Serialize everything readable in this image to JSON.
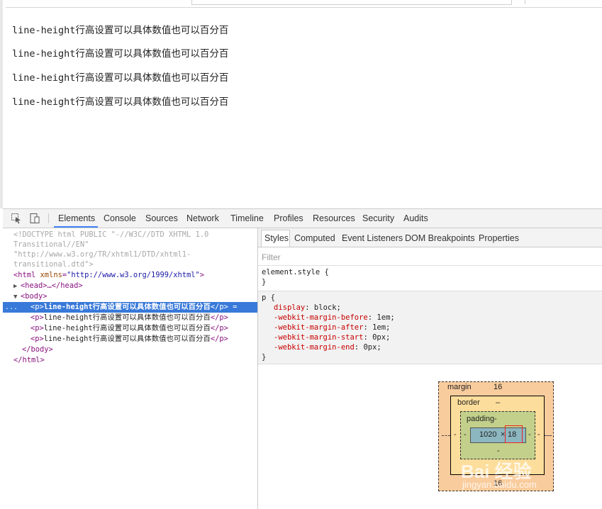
{
  "page": {
    "paragraphs": [
      "line-height行高设置可以具体数值也可以百分百",
      "line-height行高设置可以具体数值也可以百分百",
      "line-height行高设置可以具体数值也可以百分百",
      "line-height行高设置可以具体数值也可以百分百"
    ]
  },
  "devtools": {
    "tabs": [
      "Elements",
      "Console",
      "Sources",
      "Network",
      "Timeline",
      "Profiles",
      "Resources",
      "Security",
      "Audits"
    ],
    "active_tab": "Elements",
    "icons": {
      "inspect": "cursor-arrow-icon",
      "device": "mobile-device-icon"
    },
    "dom": {
      "doctype_1": "<!DOCTYPE html PUBLIC \"-//W3C//DTD XHTML 1.0",
      "doctype_2": "Transitional//EN\"",
      "doctype_3": "\"http://www.w3.org/TR/xhtml1/DTD/xhtml1-",
      "doctype_4": "transitional.dtd\">",
      "html_open": "<html",
      "html_attr": "xmlns",
      "html_val": "\"http://www.w3.org/1999/xhtml\"",
      "html_close": ">",
      "head": "<head>…</head>",
      "body_open": "<body>",
      "p_open": "<p>",
      "p_text": "line-height行高设置可以具体数值也可以百分百",
      "p_close": "</p>",
      "selected_suffix": "=",
      "body_close": "</body>",
      "html_end": "</html>",
      "dots": "..."
    },
    "sidebar_tabs": [
      "Styles",
      "Computed",
      "Event Listeners",
      "DOM Breakpoints",
      "Properties"
    ],
    "active_sidebar_tab": "Styles",
    "filter_placeholder": "Filter",
    "element_style": {
      "open": "element.style {",
      "close": "}"
    },
    "p_rule": {
      "selector": "p {",
      "close": "}",
      "declarations": [
        {
          "prop": "display",
          "value": "block;"
        },
        {
          "prop": "-webkit-margin-before",
          "value": "1em;"
        },
        {
          "prop": "-webkit-margin-after",
          "value": "1em;"
        },
        {
          "prop": "-webkit-margin-start",
          "value": "0px;"
        },
        {
          "prop": "-webkit-margin-end",
          "value": "0px;"
        }
      ]
    },
    "box_model": {
      "margin_label": "margin",
      "margin_top": "16",
      "margin_bottom": "16",
      "margin_left": "-",
      "margin_right": "-",
      "border_label": "border",
      "border_value": "–",
      "border_left": "-",
      "border_right": "-",
      "padding_label": "padding-",
      "padding_left": "-",
      "padding_right": "-",
      "padding_bottom": "-",
      "content_width": "1020",
      "content_x": "×",
      "content_height": "18"
    },
    "watermark": {
      "line1": "Bai 经验",
      "line2": "jingyan.baidu.com"
    }
  },
  "colors": {
    "selection": "#3879d9",
    "tab_underline": "#4285f4",
    "css_property": "#c80000",
    "tag": "#881280"
  }
}
